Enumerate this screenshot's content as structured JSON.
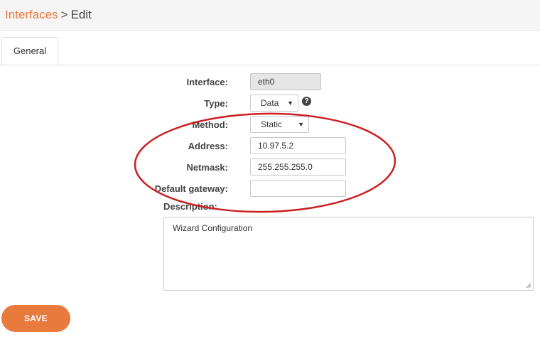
{
  "breadcrumb": {
    "parent": "Interfaces",
    "separator": ">",
    "current": "Edit"
  },
  "tabs": [
    {
      "label": "General"
    }
  ],
  "form": {
    "interface": {
      "label": "Interface:",
      "value": "eth0"
    },
    "type": {
      "label": "Type:",
      "value": "Data",
      "help_icon": "question-circle-icon"
    },
    "method": {
      "label": "Method:",
      "value": "Static"
    },
    "address": {
      "label": "Address:",
      "value": "10.97.5.2"
    },
    "netmask": {
      "label": "Netmask:",
      "value": "255.255.255.0"
    },
    "gateway": {
      "label": "Default gateway:",
      "value": ""
    },
    "description": {
      "label": "Description:",
      "value": "Wizard Configuration"
    }
  },
  "save_label": "SAVE",
  "colors": {
    "accent": "#e87a3e",
    "annotation": "#cc1f1f"
  }
}
